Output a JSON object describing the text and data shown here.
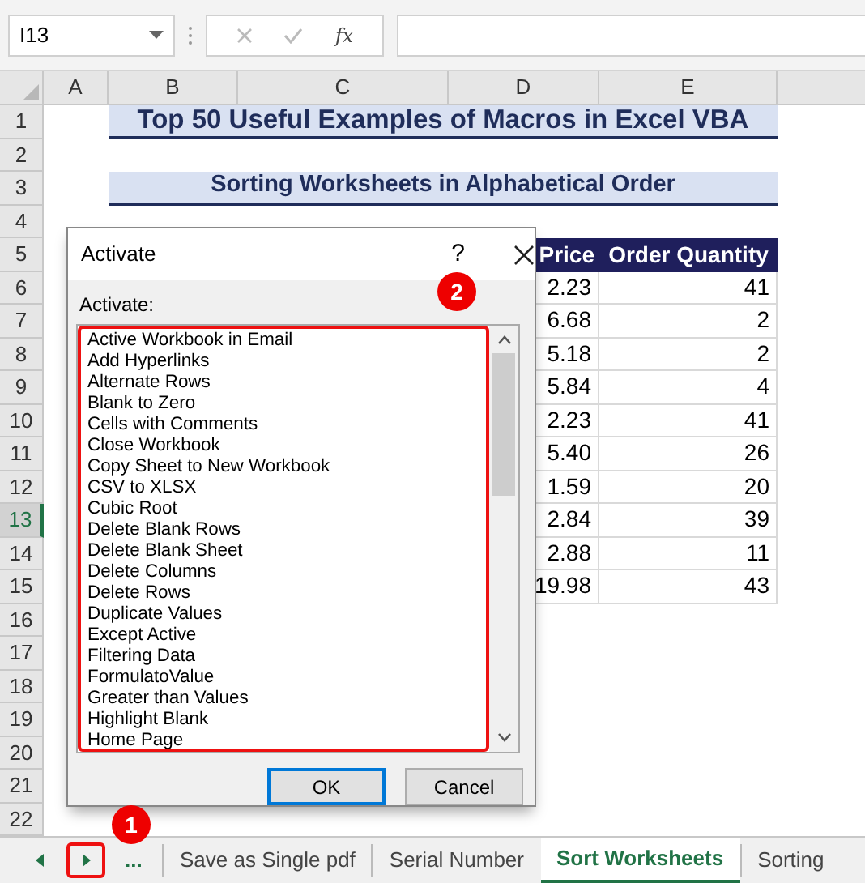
{
  "name_box": "I13",
  "formula_bar": {
    "function_label": "fx"
  },
  "columns": [
    "A",
    "B",
    "C",
    "D",
    "E"
  ],
  "rows": [
    {
      "number": "1",
      "selected": false
    },
    {
      "number": "2",
      "selected": false
    },
    {
      "number": "3",
      "selected": false
    },
    {
      "number": "4",
      "selected": false
    },
    {
      "number": "5",
      "selected": false
    },
    {
      "number": "6",
      "selected": false
    },
    {
      "number": "7",
      "selected": false
    },
    {
      "number": "8",
      "selected": false
    },
    {
      "number": "9",
      "selected": false
    },
    {
      "number": "10",
      "selected": false
    },
    {
      "number": "11",
      "selected": false
    },
    {
      "number": "12",
      "selected": false
    },
    {
      "number": "13",
      "selected": true
    },
    {
      "number": "14",
      "selected": false
    },
    {
      "number": "15",
      "selected": false
    },
    {
      "number": "16",
      "selected": false
    },
    {
      "number": "17",
      "selected": false
    },
    {
      "number": "18",
      "selected": false
    },
    {
      "number": "19",
      "selected": false
    },
    {
      "number": "20",
      "selected": false
    },
    {
      "number": "21",
      "selected": false
    },
    {
      "number": "22",
      "selected": false
    }
  ],
  "title": "Top 50 Useful Examples of Macros in Excel VBA",
  "subtitle": "Sorting Worksheets in Alphabetical Order",
  "table": {
    "headers": [
      "Price",
      "Order Quantity"
    ],
    "rows": [
      [
        "2.23",
        "41"
      ],
      [
        "6.68",
        "2"
      ],
      [
        "5.18",
        "2"
      ],
      [
        "5.84",
        "4"
      ],
      [
        "2.23",
        "41"
      ],
      [
        "5.40",
        "26"
      ],
      [
        "1.59",
        "20"
      ],
      [
        "2.84",
        "39"
      ],
      [
        "2.88",
        "11"
      ],
      [
        "19.98",
        "43"
      ]
    ]
  },
  "dialog": {
    "title": "Activate",
    "help": "?",
    "label": "Activate:",
    "items": [
      "Active Workbook in Email",
      "Add Hyperlinks",
      "Alternate Rows",
      "Blank to Zero",
      "Cells with Comments",
      "Close Workbook",
      "Copy Sheet to New Workbook",
      "CSV to XLSX",
      "Cubic Root",
      "Delete Blank Rows",
      "Delete Blank Sheet",
      "Delete Columns",
      "Delete Rows",
      "Duplicate Values",
      "Except Active",
      "Filtering Data",
      "FormulatoValue",
      "Greater than Values",
      "Highlight Blank",
      "Home Page"
    ],
    "buttons": [
      {
        "label": "OK",
        "default": true
      },
      {
        "label": "Cancel",
        "default": false
      }
    ]
  },
  "sheet_tabs": {
    "more": "...",
    "tabs": [
      {
        "label": "Save as Single pdf",
        "selected": false
      },
      {
        "label": "Serial Number",
        "selected": false
      },
      {
        "label": "Sort Worksheets",
        "selected": true
      },
      {
        "label": "Sorting",
        "selected": false
      }
    ]
  },
  "callouts": [
    "2",
    "1"
  ]
}
